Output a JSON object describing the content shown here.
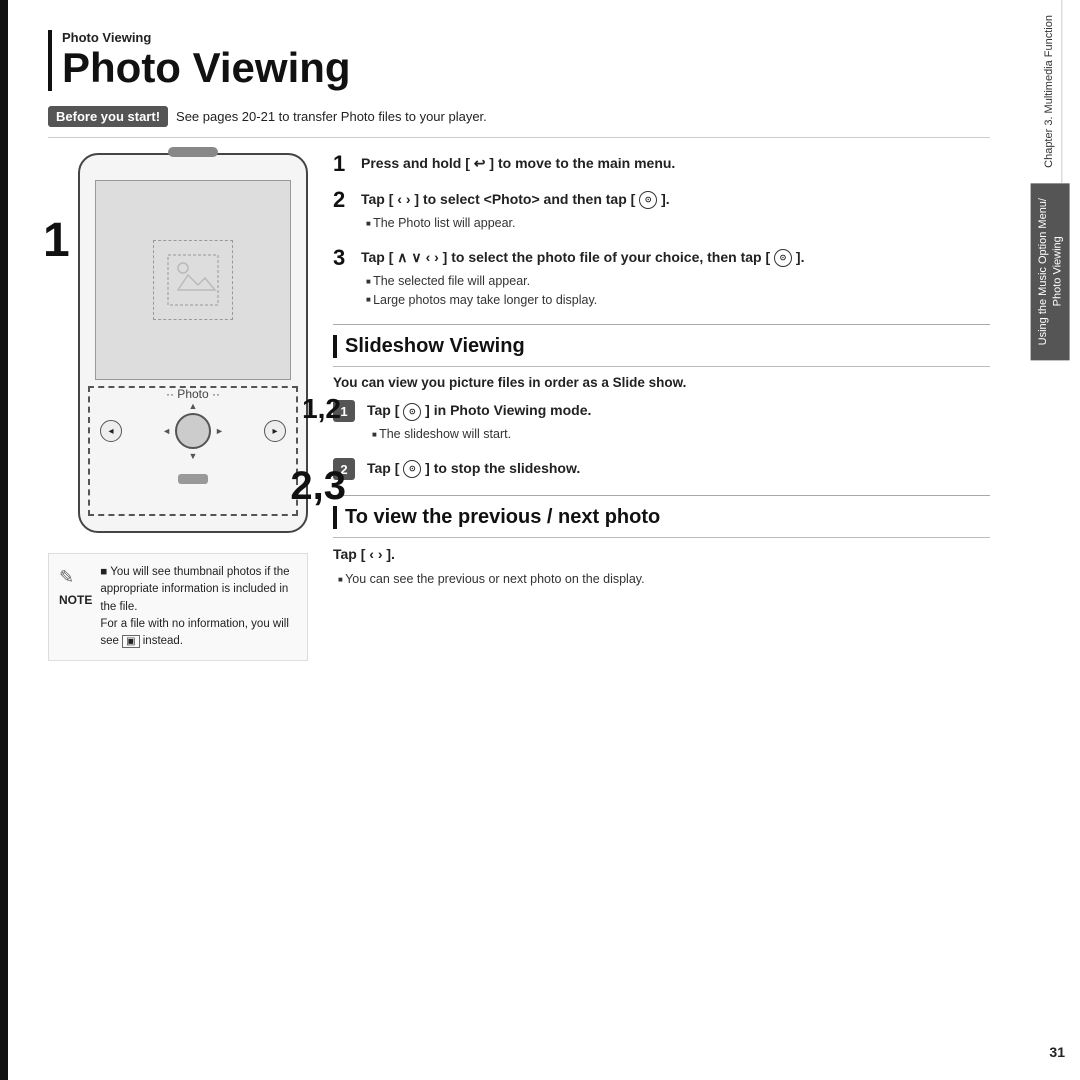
{
  "page": {
    "title": "Photo Viewing",
    "section_label": "Photo Viewing",
    "page_number": "31"
  },
  "before_start": {
    "label": "Before you start!",
    "text": "See pages 20-21 to transfer Photo files to your player."
  },
  "steps": [
    {
      "number": "1",
      "text_bold": "Press and hold [ ↩ ] to move to the main menu."
    },
    {
      "number": "2",
      "text_bold": "Tap [ ‹ › ] to select <Photo> and then tap [ ⊙ ].",
      "bullets": [
        "The Photo list will appear."
      ]
    },
    {
      "number": "3",
      "text_bold": "Tap [ ∧ ∨ ‹ › ] to select the photo file of your choice, then tap [ ⊙ ].",
      "bullets": [
        "The selected file will appear.",
        "Large photos may take longer to display."
      ]
    }
  ],
  "slideshow": {
    "title": "Slideshow Viewing",
    "intro": "You can view you picture files in order as a Slide show.",
    "steps": [
      {
        "number": "1",
        "text_bold": "Tap [ ⊙ ] in Photo Viewing mode.",
        "bullets": [
          "The slideshow will start."
        ]
      },
      {
        "number": "2",
        "text_bold": "Tap [ ⊙ ] to stop the slideshow."
      }
    ]
  },
  "next_prev": {
    "title": "To view the previous / next photo",
    "tap_text": "Tap [ ‹  › ].",
    "bullets": [
      "You can see the previous or next photo on the display."
    ]
  },
  "note": {
    "icon": "✎",
    "label": "NOTE",
    "lines": [
      "You will see thumbnail photos if the appropriate information is included in the file.",
      "For a file with no information, you will see  instead."
    ]
  },
  "device": {
    "photo_label": "·· Photo ··"
  },
  "sidebar": {
    "top_label": "Chapter 3. Multimedia Function",
    "bottom_label": "Using the Music Option Menu/ Photo Viewing"
  }
}
